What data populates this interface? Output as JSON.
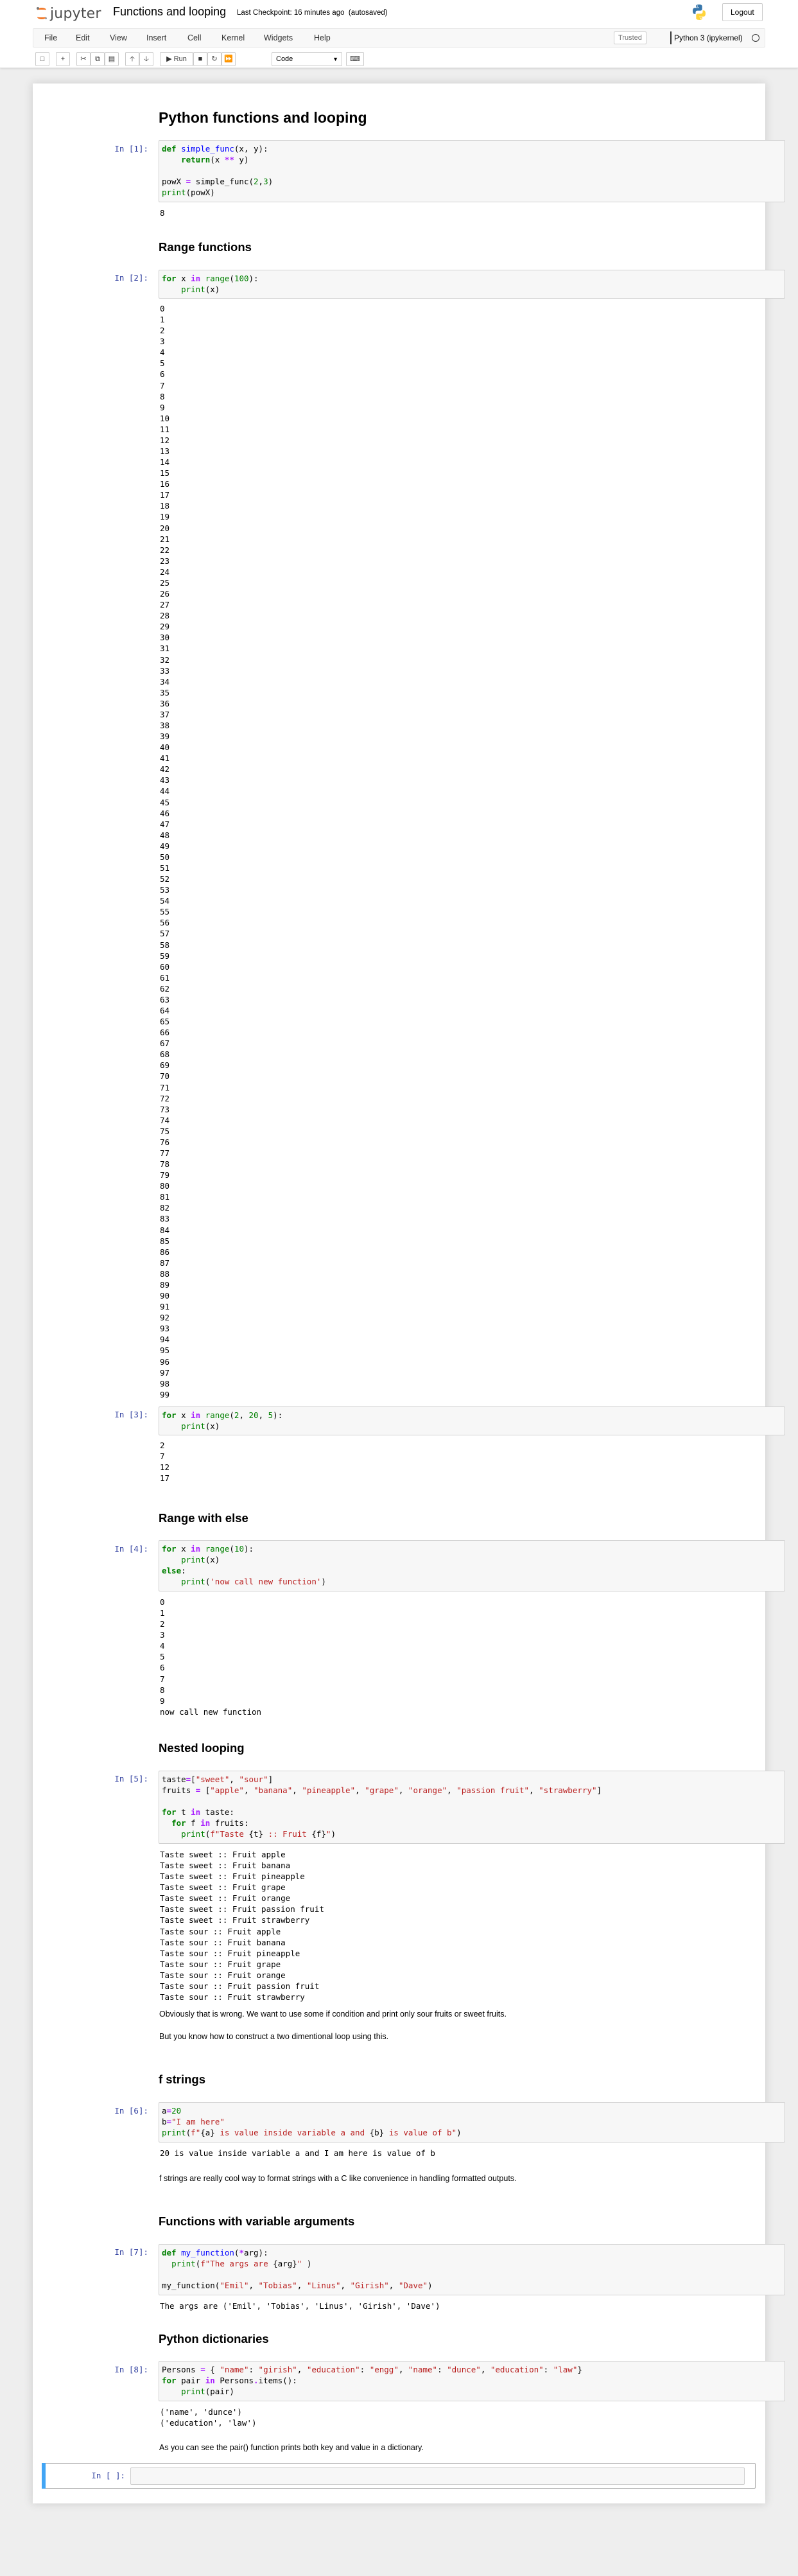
{
  "header": {
    "logo_text": "jupyter",
    "notebook_name": "Functions and looping",
    "checkpoint": "Last Checkpoint: 16 minutes ago",
    "autosaved": "(autosaved)",
    "logout_label": "Logout"
  },
  "menu": [
    "File",
    "Edit",
    "View",
    "Insert",
    "Cell",
    "Kernel",
    "Widgets",
    "Help"
  ],
  "status": {
    "trusted": "Trusted",
    "kernel_name": "Python 3 (ipykernel)"
  },
  "toolbar": {
    "run_label": "Run",
    "cell_type": "Code",
    "icons": [
      "save-icon",
      "add-cell-icon",
      "cut-icon",
      "copy-icon",
      "paste-icon",
      "move-up-icon",
      "move-down-icon",
      "run-icon",
      "stop-icon",
      "restart-icon",
      "restart-run-all-icon",
      "keyboard-icon"
    ]
  },
  "headings": {
    "title": "Python functions and looping",
    "range_functions": "Range functions",
    "range_else": "Range with else",
    "nested_looping": "Nested looping",
    "f_strings": "f strings",
    "variable_args": "Functions with variable arguments",
    "dictionaries": "Python dictionaries"
  },
  "cells": [
    {
      "prompt": "In [1]:",
      "source": [
        "def simple_func(x, y):",
        "    return(x ** y)",
        "",
        "powX = simple_func(2,3)",
        "print(powX)"
      ],
      "output": [
        "8"
      ]
    },
    {
      "prompt": "In [2]:",
      "source": [
        "for x in range(100):",
        "    print(x)"
      ],
      "output_range": [
        0,
        99
      ]
    },
    {
      "prompt": "In [3]:",
      "source": [
        "for x in range(2, 20, 5):",
        "    print(x)"
      ],
      "output": [
        "2",
        "7",
        "12",
        "17"
      ]
    },
    {
      "prompt": "In [4]:",
      "source": [
        "for x in range(10):",
        "    print(x)",
        "else:",
        "    print('now call new function')"
      ],
      "output": [
        "0",
        "1",
        "2",
        "3",
        "4",
        "5",
        "6",
        "7",
        "8",
        "9",
        "now call new function"
      ]
    },
    {
      "prompt": "In [5]:",
      "source": [
        "taste=[\"sweet\", \"sour\"]",
        "fruits = [\"apple\", \"banana\", \"pineapple\", \"grape\", \"orange\", \"passion fruit\", \"strawberry\"]",
        "",
        "for t in taste:",
        "  for f in fruits:",
        "    print(f\"Taste {t} :: Fruit {f}\")"
      ],
      "output": [
        "Taste sweet :: Fruit apple",
        "Taste sweet :: Fruit banana",
        "Taste sweet :: Fruit pineapple",
        "Taste sweet :: Fruit grape",
        "Taste sweet :: Fruit orange",
        "Taste sweet :: Fruit passion fruit",
        "Taste sweet :: Fruit strawberry",
        "Taste sour :: Fruit apple",
        "Taste sour :: Fruit banana",
        "Taste sour :: Fruit pineapple",
        "Taste sour :: Fruit grape",
        "Taste sour :: Fruit orange",
        "Taste sour :: Fruit passion fruit",
        "Taste sour :: Fruit strawberry"
      ]
    },
    {
      "prompt": "In [6]:",
      "source": [
        "a=20",
        "b=\"I am here\"",
        "print(f\"{a} is value inside variable a and {b} is value of b\")"
      ],
      "output": [
        "20 is value inside variable a and I am here is value of b"
      ]
    },
    {
      "prompt": "In [7]:",
      "source": [
        "def my_function(*arg):",
        "  print(f\"The args are {arg}\" )",
        "",
        "my_function(\"Emil\", \"Tobias\", \"Linus\", \"Girish\", \"Dave\")"
      ],
      "output": [
        "The args are ('Emil', 'Tobias', 'Linus', 'Girish', 'Dave')"
      ]
    },
    {
      "prompt": "In [8]:",
      "source": [
        "Persons = { \"name\": \"girish\", \"education\": \"engg\", \"name\": \"dunce\", \"education\": \"law\"}",
        "for pair in Persons.items():",
        "    print(pair)"
      ],
      "output": [
        "('name', 'dunce')",
        "('education', 'law')"
      ]
    }
  ],
  "markdown": {
    "nested_note1": "Obviously that is wrong. We want to use some if condition and print only sour fruits or sweet fruits.",
    "nested_note2": "But you know how to construct a two dimentional loop using this.",
    "fstring_note": "f strings are really cool way to format strings with a C like convenience in handling formatted outputs.",
    "dict_note": "As you can see the pair() function prints both key and value in a dictionary."
  },
  "empty_cell_prompt": "In [ ]:",
  "colors": {
    "prompt": "#303f9f",
    "keyword": "#008000",
    "string": "#ba2121",
    "function": "#0000ff",
    "selected_cell": "#42a5f5",
    "logo_orange": "#f37726"
  }
}
